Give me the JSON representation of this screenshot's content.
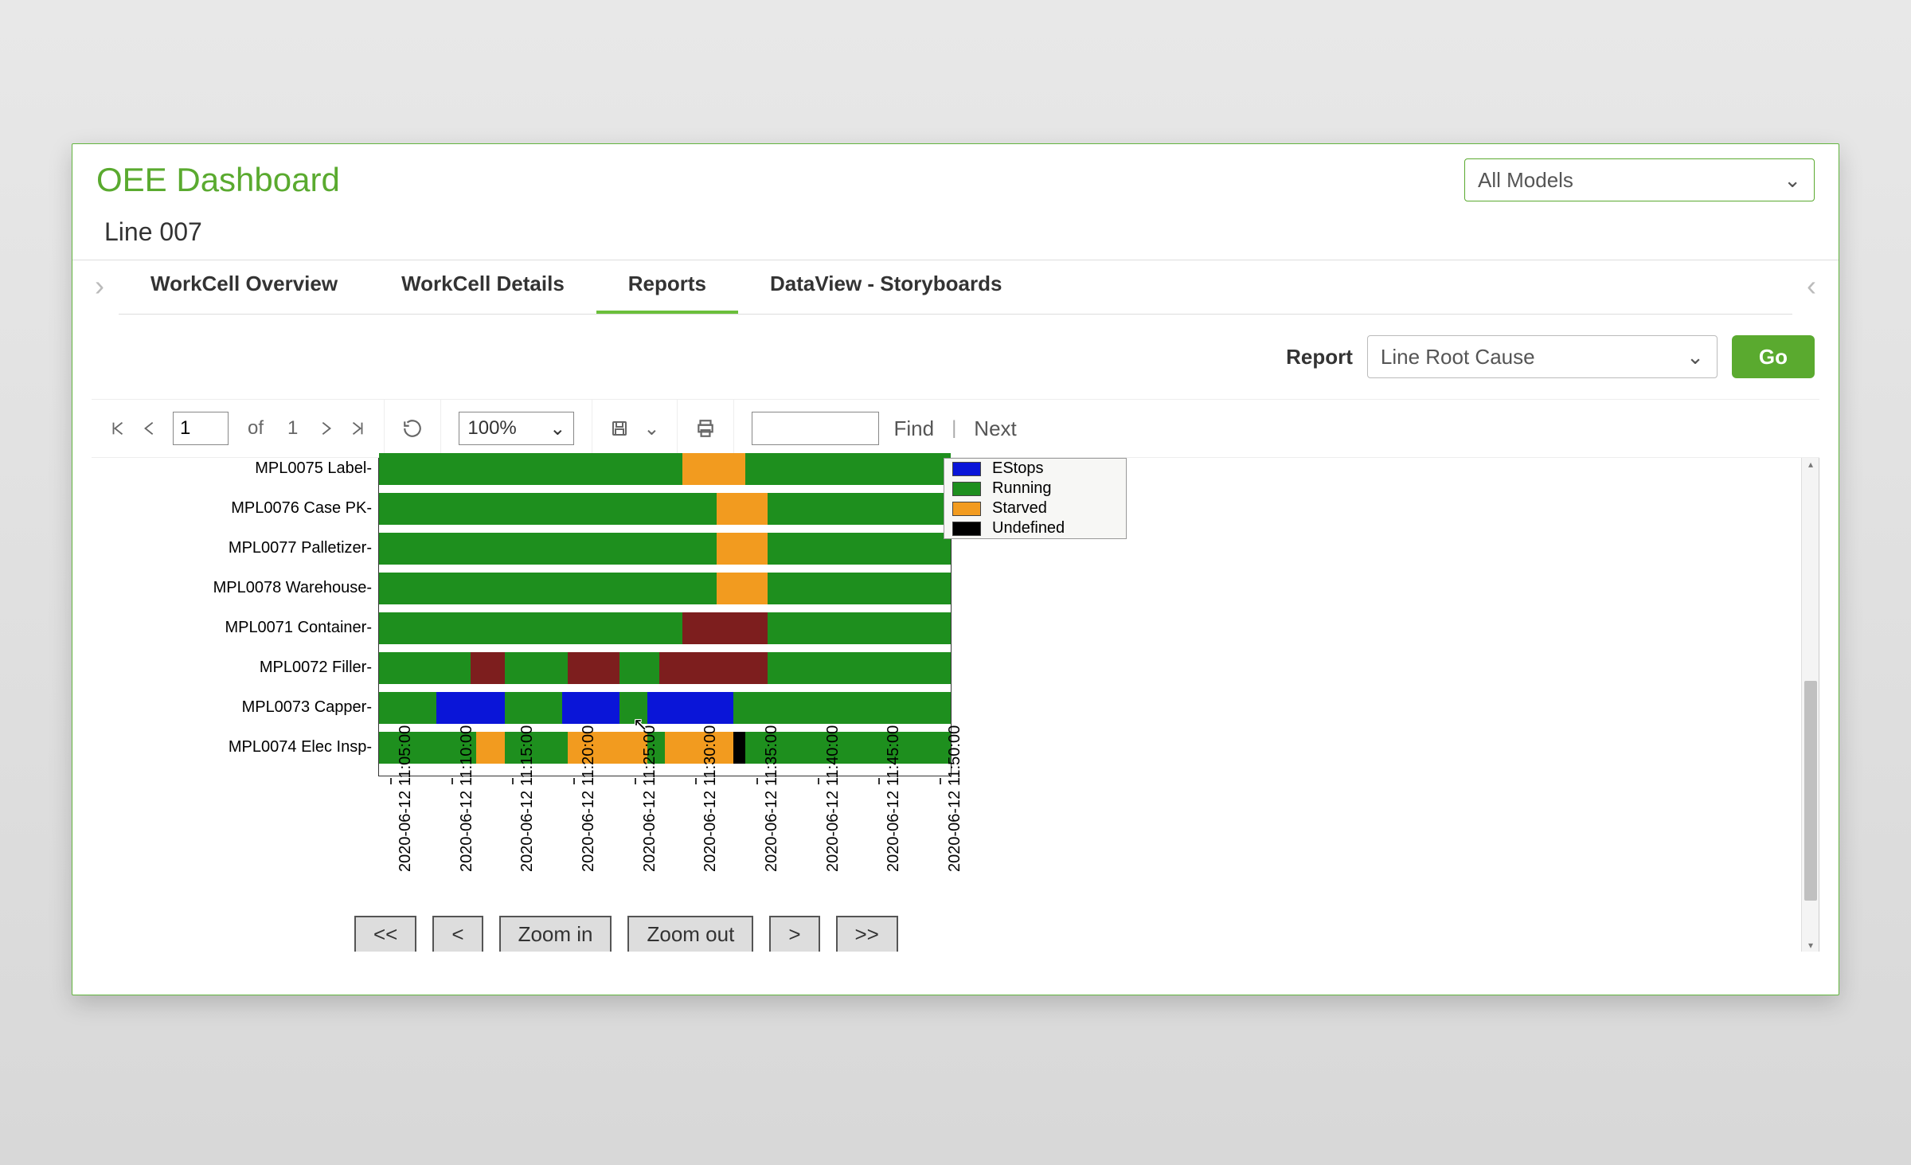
{
  "header": {
    "title": "OEE Dashboard",
    "models_selected": "All Models"
  },
  "line": {
    "title": "Line 007"
  },
  "tabs": {
    "items": [
      {
        "label": "WorkCell Overview"
      },
      {
        "label": "WorkCell Details"
      },
      {
        "label": "Reports"
      },
      {
        "label": "DataView - Storyboards"
      }
    ],
    "active_index": 2
  },
  "report": {
    "label": "Report",
    "selected": "Line Root Cause",
    "go_label": "Go"
  },
  "toolbar": {
    "page_value": "1",
    "of_label": "of",
    "total_pages": "1",
    "zoom_value": "100%",
    "find_label": "Find",
    "next_label": "Next"
  },
  "legend": [
    {
      "label": "EStops",
      "color": "#0a15d8"
    },
    {
      "label": "Running",
      "color": "#1e8f1e"
    },
    {
      "label": "Starved",
      "color": "#f29b1f"
    },
    {
      "label": "Undefined",
      "color": "#000000"
    }
  ],
  "nav": {
    "first": "<<",
    "prev": "<",
    "zoom_in": "Zoom in",
    "zoom_out": "Zoom out",
    "next": ">",
    "last": ">>"
  },
  "chart_data": {
    "type": "gantt",
    "title": "Line Root Cause",
    "x_axis": {
      "ticks": [
        "2020-06-12 11:05:00",
        "2020-06-12 11:10:00",
        "2020-06-12 11:15:00",
        "2020-06-12 11:20:00",
        "2020-06-12 11:25:00",
        "2020-06-12 11:30:00",
        "2020-06-12 11:35:00",
        "2020-06-12 11:40:00",
        "2020-06-12 11:45:00",
        "2020-06-12 11:50:00"
      ],
      "range_pct": [
        0,
        100
      ]
    },
    "colors": {
      "Running": "#1e8f1e",
      "EStops": "#0a15d8",
      "Starved": "#f29b1f",
      "Undefined": "#000000",
      "DarkRed": "#7d1e1e"
    },
    "rows": [
      {
        "label": "MPL0075 Label",
        "segments": [
          {
            "state": "Running",
            "start_pct": 0,
            "end_pct": 53
          },
          {
            "state": "Starved",
            "start_pct": 53,
            "end_pct": 64
          },
          {
            "state": "Running",
            "start_pct": 64,
            "end_pct": 100
          }
        ]
      },
      {
        "label": "MPL0076 Case PK",
        "segments": [
          {
            "state": "Running",
            "start_pct": 0,
            "end_pct": 59
          },
          {
            "state": "Starved",
            "start_pct": 59,
            "end_pct": 68
          },
          {
            "state": "Running",
            "start_pct": 68,
            "end_pct": 100
          }
        ]
      },
      {
        "label": "MPL0077 Palletizer",
        "segments": [
          {
            "state": "Running",
            "start_pct": 0,
            "end_pct": 59
          },
          {
            "state": "Starved",
            "start_pct": 59,
            "end_pct": 68
          },
          {
            "state": "Running",
            "start_pct": 68,
            "end_pct": 100
          }
        ]
      },
      {
        "label": "MPL0078 Warehouse",
        "segments": [
          {
            "state": "Running",
            "start_pct": 0,
            "end_pct": 59
          },
          {
            "state": "Starved",
            "start_pct": 59,
            "end_pct": 68
          },
          {
            "state": "Running",
            "start_pct": 68,
            "end_pct": 100
          }
        ]
      },
      {
        "label": "MPL0071 Container",
        "segments": [
          {
            "state": "Running",
            "start_pct": 0,
            "end_pct": 53
          },
          {
            "state": "DarkRed",
            "start_pct": 53,
            "end_pct": 68
          },
          {
            "state": "Running",
            "start_pct": 68,
            "end_pct": 100
          }
        ]
      },
      {
        "label": "MPL0072 Filler",
        "segments": [
          {
            "state": "Running",
            "start_pct": 0,
            "end_pct": 16
          },
          {
            "state": "DarkRed",
            "start_pct": 16,
            "end_pct": 22
          },
          {
            "state": "Running",
            "start_pct": 22,
            "end_pct": 33
          },
          {
            "state": "DarkRed",
            "start_pct": 33,
            "end_pct": 42
          },
          {
            "state": "Running",
            "start_pct": 42,
            "end_pct": 49
          },
          {
            "state": "DarkRed",
            "start_pct": 49,
            "end_pct": 68
          },
          {
            "state": "Running",
            "start_pct": 68,
            "end_pct": 100
          }
        ]
      },
      {
        "label": "MPL0073 Capper",
        "segments": [
          {
            "state": "Running",
            "start_pct": 0,
            "end_pct": 10
          },
          {
            "state": "EStops",
            "start_pct": 10,
            "end_pct": 22
          },
          {
            "state": "Running",
            "start_pct": 22,
            "end_pct": 32
          },
          {
            "state": "EStops",
            "start_pct": 32,
            "end_pct": 42
          },
          {
            "state": "Running",
            "start_pct": 42,
            "end_pct": 47
          },
          {
            "state": "EStops",
            "start_pct": 47,
            "end_pct": 62
          },
          {
            "state": "Running",
            "start_pct": 62,
            "end_pct": 100
          }
        ]
      },
      {
        "label": "MPL0074 Elec Insp",
        "segments": [
          {
            "state": "Running",
            "start_pct": 0,
            "end_pct": 17
          },
          {
            "state": "Starved",
            "start_pct": 17,
            "end_pct": 22
          },
          {
            "state": "Running",
            "start_pct": 22,
            "end_pct": 33
          },
          {
            "state": "Starved",
            "start_pct": 33,
            "end_pct": 47
          },
          {
            "state": "Running",
            "start_pct": 47,
            "end_pct": 50
          },
          {
            "state": "Starved",
            "start_pct": 50,
            "end_pct": 62
          },
          {
            "state": "Undefined",
            "start_pct": 62,
            "end_pct": 64
          },
          {
            "state": "Running",
            "start_pct": 64,
            "end_pct": 100
          }
        ]
      }
    ]
  }
}
